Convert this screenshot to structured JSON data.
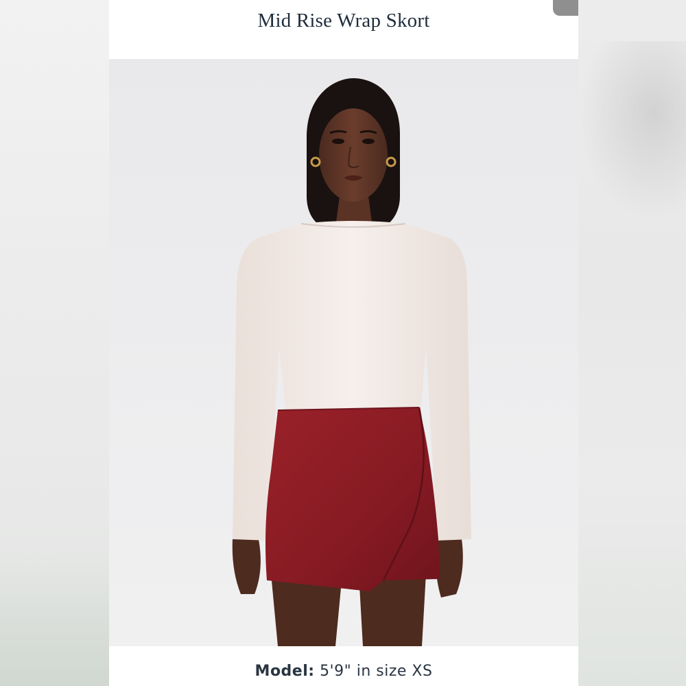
{
  "product": {
    "title": "Mid Rise Wrap Skort"
  },
  "image": {
    "description_icon": "product-photo",
    "top_color": "#f3ece8",
    "skort_color": "#8a1c24"
  },
  "caption": {
    "label": "Model:",
    "text": "5'9\" in size XS"
  }
}
